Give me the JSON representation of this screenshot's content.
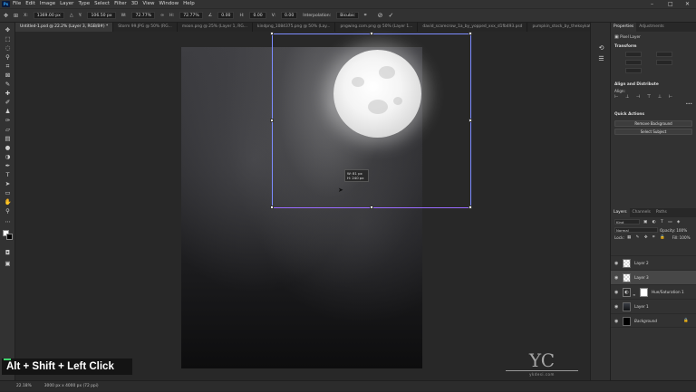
{
  "app": {
    "logo": "Ps"
  },
  "menu": [
    "File",
    "Edit",
    "Image",
    "Layer",
    "Type",
    "Select",
    "Filter",
    "3D",
    "View",
    "Window",
    "Help"
  ],
  "window_controls": {
    "minimize": "–",
    "maximize": "□",
    "close": "✕"
  },
  "options": {
    "x_label": "X:",
    "x_value": "1369.00 px",
    "y_label": "Y:",
    "y_value": "106.50 px",
    "w_label": "W:",
    "w_value": "72.77%",
    "h_label": "H:",
    "h_value": "72.77%",
    "angle_value": "0.00",
    "hskew_label": "H:",
    "hskew_value": "0.00",
    "vskew_label": "V:",
    "vskew_value": "0.00",
    "interp_label": "Interpolation:",
    "interp_value": "Bicubic",
    "cancel_icon": "⊘",
    "commit_icon": "✓"
  },
  "tabs": [
    {
      "label": "Untitled-1.psd @ 22.2% (Layer 3, RGB/8#) *",
      "active": true
    },
    {
      "label": "Storm 99.JPG @ 50% (RG...",
      "active": false
    },
    {
      "label": "moon.png @ 25% (Layer 1, RG...",
      "active": false
    },
    {
      "label": "kindpng_1084375.png @ 50% (Lay...",
      "active": false
    },
    {
      "label": "pngwing.com.png @ 50% (Layer 1...",
      "active": false
    },
    {
      "label": "david_scarecrow_1a_by_yopped_xxx_d1fb493.psd",
      "active": false
    },
    {
      "label": "pumpkin_stock_by_thekoykat_s...",
      "active": false
    }
  ],
  "tooltip": {
    "w_label": "W:",
    "w_value": "81 px",
    "h_label": "H:",
    "h_value": "240 px"
  },
  "status": {
    "zoom": "22.18%",
    "doc_size": "3000 px x 4000 px (72 ppi)"
  },
  "overlay": {
    "shortcut": "Alt + Shift + Left Click"
  },
  "watermark": {
    "mark": "YC",
    "site": "ykdesi.com"
  },
  "properties": {
    "tabs": [
      "Properties",
      "Adjustments"
    ],
    "kind_label": "Pixel Layer",
    "transform_title": "Transform",
    "align_title": "Align and Distribute",
    "align_sub": "Align:",
    "more": "•••",
    "quick_title": "Quick Actions",
    "remove_bg": "Remove Background",
    "select_subject": "Select Subject"
  },
  "layers_panel": {
    "tabs": [
      "Layers",
      "Channels",
      "Paths"
    ],
    "kind_placeholder": "Kind",
    "blend_mode": "Normal",
    "opacity_label": "Opacity:",
    "opacity_value": "100%",
    "lock_label": "Lock:",
    "fill_label": "Fill:",
    "fill_value": "100%",
    "layers": [
      {
        "name": "Layer 2",
        "thumb": "trans",
        "selected": false
      },
      {
        "name": "Layer 3",
        "thumb": "trans",
        "selected": true
      },
      {
        "name": "Hue/Saturation 1",
        "thumb": "adj",
        "selected": false
      },
      {
        "name": "Layer 1",
        "thumb": "dark",
        "selected": false
      },
      {
        "name": "Background",
        "thumb": "black",
        "selected": false
      }
    ]
  }
}
